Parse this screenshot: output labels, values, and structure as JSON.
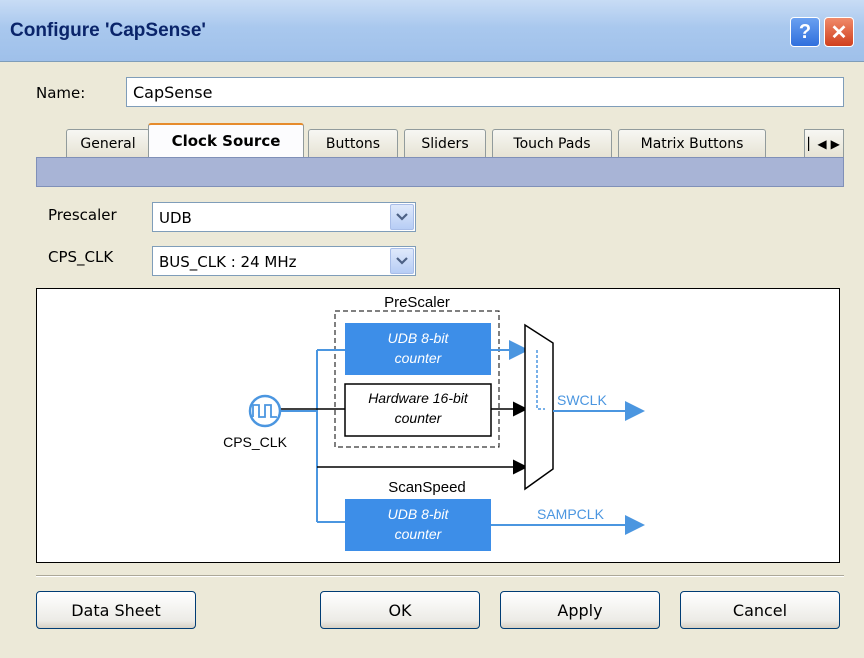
{
  "window": {
    "title": "Configure 'CapSense'",
    "help_glyph": "?",
    "close_glyph": "✕"
  },
  "name_field": {
    "label": "Name:",
    "value": "CapSense"
  },
  "tabs": [
    {
      "label": "General"
    },
    {
      "label": "Clock Source"
    },
    {
      "label": "Buttons"
    },
    {
      "label": "Sliders"
    },
    {
      "label": "Touch Pads"
    },
    {
      "label": "Matrix Buttons"
    }
  ],
  "tab_scroll": {
    "left_glyph": "▏◀",
    "right_glyph": "▶"
  },
  "settings": {
    "prescaler": {
      "label": "Prescaler",
      "value": "UDB"
    },
    "cps_clk": {
      "label": "CPS_CLK",
      "value": "BUS_CLK : 24 MHz"
    }
  },
  "diagram": {
    "prescaler_label": "PreScaler",
    "udb_counter_1": [
      "UDB 8-bit",
      "counter"
    ],
    "hw_counter": [
      "Hardware 16-bit",
      "counter"
    ],
    "clock_source_label": "CPS_CLK",
    "swclk_label": "SWCLK",
    "scanspeed_label": "ScanSpeed",
    "udb_counter_2": [
      "UDB 8-bit",
      "counter"
    ],
    "sampclk_label": "SAMPCLK",
    "colors": {
      "blue_block": "#3d8ee8",
      "blue_line": "#4b96e0"
    }
  },
  "buttons": {
    "data_sheet": "Data Sheet",
    "ok": "OK",
    "apply": "Apply",
    "cancel": "Cancel"
  }
}
